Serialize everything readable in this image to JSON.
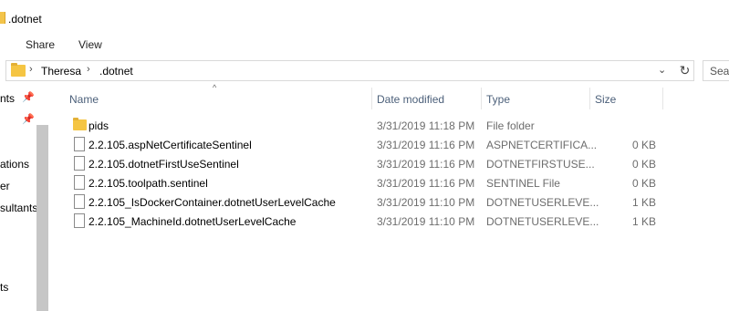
{
  "window": {
    "title": ".dotnet"
  },
  "ribbon": {
    "tabs": [
      "Share",
      "View"
    ]
  },
  "address": {
    "crumbs": [
      "Theresa",
      ".dotnet"
    ],
    "separator": "›",
    "dropdown": "⌄",
    "refresh": "↻"
  },
  "search": {
    "placeholder": "Sear"
  },
  "nav": {
    "items": [
      {
        "label": "nts",
        "pinned": true
      },
      {
        "label": "",
        "pinned": true
      },
      {
        "label": "ations",
        "pinned": false
      },
      {
        "label": "er",
        "pinned": false
      },
      {
        "label": "sultants",
        "pinned": false
      },
      {
        "label": "ts",
        "pinned": false
      }
    ],
    "pin_glyph": "📌"
  },
  "columns": {
    "name": "Name",
    "date": "Date modified",
    "type": "Type",
    "size": "Size",
    "sort_glyph": "^"
  },
  "files": [
    {
      "name": "pids",
      "date": "3/31/2019 11:18 PM",
      "type": "File folder",
      "size": "",
      "kind": "folder"
    },
    {
      "name": "2.2.105.aspNetCertificateSentinel",
      "date": "3/31/2019 11:16 PM",
      "type": "ASPNETCERTIFICA...",
      "size": "0 KB",
      "kind": "file"
    },
    {
      "name": "2.2.105.dotnetFirstUseSentinel",
      "date": "3/31/2019 11:16 PM",
      "type": "DOTNETFIRSTUSE...",
      "size": "0 KB",
      "kind": "file"
    },
    {
      "name": "2.2.105.toolpath.sentinel",
      "date": "3/31/2019 11:16 PM",
      "type": "SENTINEL File",
      "size": "0 KB",
      "kind": "file"
    },
    {
      "name": "2.2.105_IsDockerContainer.dotnetUserLevelCache",
      "date": "3/31/2019 11:10 PM",
      "type": "DOTNETUSERLEVE...",
      "size": "1 KB",
      "kind": "file"
    },
    {
      "name": "2.2.105_MachineId.dotnetUserLevelCache",
      "date": "3/31/2019 11:10 PM",
      "type": "DOTNETUSERLEVE...",
      "size": "1 KB",
      "kind": "file"
    }
  ]
}
